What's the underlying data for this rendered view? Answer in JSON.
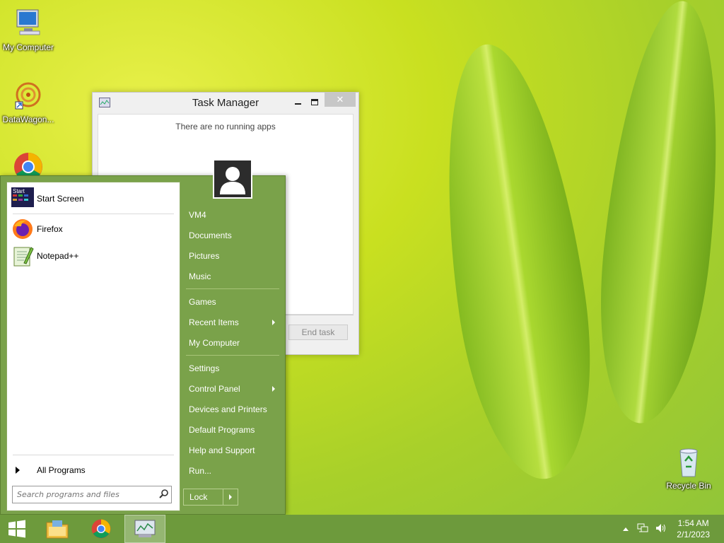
{
  "desktop": {
    "icons": [
      {
        "label": "My Computer",
        "icon": "computer-icon"
      },
      {
        "label": "DataWagon...",
        "icon": "datawagon-icon"
      },
      {
        "label": "Recycle Bin",
        "icon": "recycle-bin-icon"
      }
    ]
  },
  "task_manager": {
    "title": "Task Manager",
    "empty_message": "There are no running apps",
    "end_task_label": "End task"
  },
  "start_menu": {
    "programs": [
      {
        "label": "Start Screen",
        "icon": "start-screen-icon"
      },
      {
        "label": "Firefox",
        "icon": "firefox-icon"
      },
      {
        "label": "Notepad++",
        "icon": "notepad-plus-plus-icon"
      }
    ],
    "all_programs_label": "All Programs",
    "search_placeholder": "Search programs and files",
    "places": [
      {
        "label": "VM4"
      },
      {
        "label": "Documents"
      },
      {
        "label": "Pictures"
      },
      {
        "label": "Music"
      },
      {
        "label": "Games"
      },
      {
        "label": "Recent Items"
      },
      {
        "label": "My Computer"
      },
      {
        "label": "Settings"
      },
      {
        "label": "Control Panel"
      },
      {
        "label": "Devices and Printers"
      },
      {
        "label": "Default Programs"
      },
      {
        "label": "Help and Support"
      },
      {
        "label": "Run..."
      }
    ],
    "lock_label": "Lock"
  },
  "taskbar": {
    "time": "1:54 AM",
    "date": "2/1/2023"
  },
  "colors": {
    "start_menu_green": "#7aa24a",
    "taskbar_green": "#6d9a3c"
  }
}
